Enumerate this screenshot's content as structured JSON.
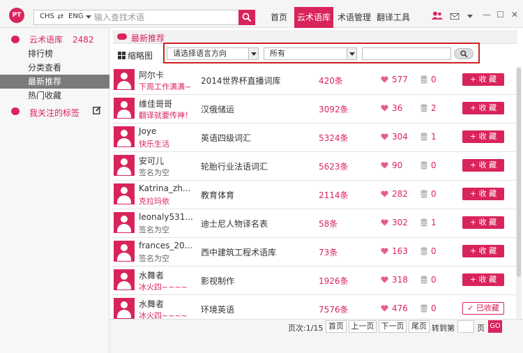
{
  "logo": {
    "text": "PT"
  },
  "search": {
    "lang_src": "CHS",
    "lang_dst": "ENG",
    "placeholder": "输入查找术语"
  },
  "nav": [
    "首页",
    "云术语库",
    "术语管理",
    "翻译工具"
  ],
  "window": {
    "min": "—",
    "max": "☐",
    "close": "✕"
  },
  "sidebar": {
    "title": "云术语库",
    "count": "2482",
    "items": [
      "排行榜",
      "分类查看",
      "最新推荐",
      "热门收藏"
    ],
    "tags_label": "我关注的标签"
  },
  "content": {
    "title": "最新推荐"
  },
  "filter": {
    "thumb_label": "缩略图",
    "lang_select": "请选择语言方向",
    "category_select": "所有"
  },
  "rows": [
    {
      "user": "阿尔卡",
      "sign": "下周工作满满~",
      "sign_empty": false,
      "lib": "2014世界杯直播词库",
      "terms": "420条",
      "likes": "577",
      "count": "0",
      "btn": "+ 收 藏"
    },
    {
      "user": "维佳哥哥",
      "sign": "翻译就要传神！",
      "sign_empty": false,
      "lib": "汉俄储运",
      "terms": "3092条",
      "likes": "36",
      "count": "2",
      "btn": "+ 收 藏"
    },
    {
      "user": "Joye",
      "sign": "快乐生活",
      "sign_empty": false,
      "lib": "英语四级词汇",
      "terms": "5324条",
      "likes": "304",
      "count": "1",
      "btn": "+ 收 藏"
    },
    {
      "user": "安可儿",
      "sign": "签名为空",
      "sign_empty": true,
      "lib": "轮胎行业法语词汇",
      "terms": "5623条",
      "likes": "90",
      "count": "0",
      "btn": "+ 收 藏"
    },
    {
      "user": "Katrina_zh...",
      "sign": "克拉玛依",
      "sign_empty": false,
      "lib": "教育体育",
      "terms": "2114条",
      "likes": "282",
      "count": "0",
      "btn": "+ 收 藏"
    },
    {
      "user": "leonaly531...",
      "sign": "签名为空",
      "sign_empty": true,
      "lib": "迪士尼人物译名表",
      "terms": "58条",
      "likes": "302",
      "count": "1",
      "btn": "+ 收 藏"
    },
    {
      "user": "frances_20...",
      "sign": "签名为空",
      "sign_empty": true,
      "lib": "西中建筑工程术语库",
      "terms": "73条",
      "likes": "163",
      "count": "0",
      "btn": "+ 收 藏"
    },
    {
      "user": "水舞者",
      "sign": "冰火四~~~~",
      "sign_empty": false,
      "lib": "影视制作",
      "terms": "1926条",
      "likes": "318",
      "count": "0",
      "btn": "+ 收 藏"
    },
    {
      "user": "水舞者",
      "sign": "冰火四~~~~",
      "sign_empty": false,
      "lib": "环境英语",
      "terms": "7576条",
      "likes": "476",
      "count": "0",
      "btn": "✓ 已收藏"
    }
  ],
  "pager": {
    "info": "页次:1/15",
    "first": "首页",
    "prev": "上一页",
    "next": "下一页",
    "last": "尾页",
    "goto": "转到第",
    "page_unit": "页",
    "go": "GO"
  },
  "colors": {
    "accent": "#d9245b",
    "highlight_box": "#d02020",
    "active_side": "#7a7a7a"
  }
}
